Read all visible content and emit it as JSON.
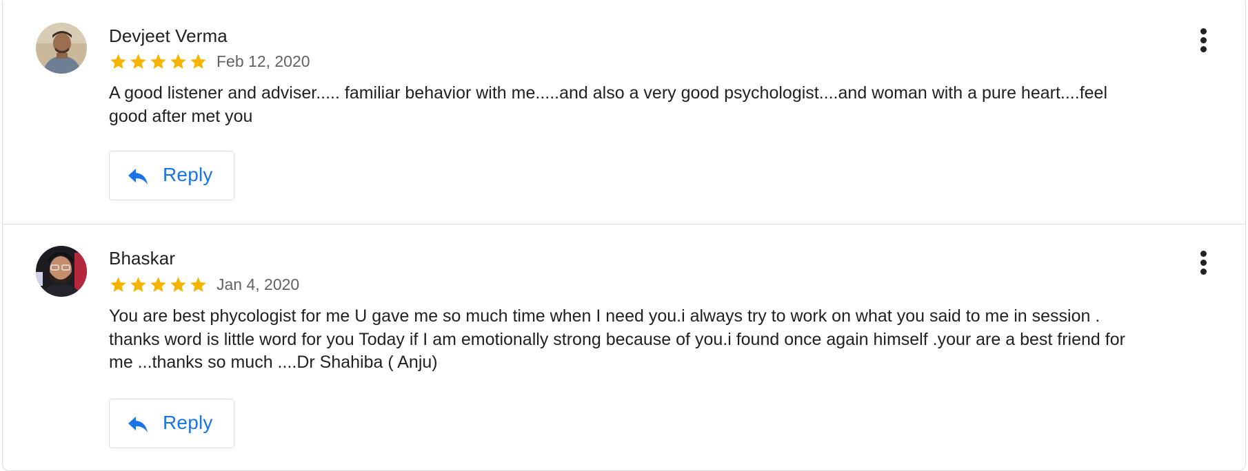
{
  "reviews": [
    {
      "author": "Devjeet Verma",
      "rating": 5,
      "max_rating": 5,
      "date": "Feb 12, 2020",
      "text": "A good listener and adviser..... familiar behavior with me.....and also a very good psychologist....and woman with a pure heart....feel good after met you",
      "reply_label": "Reply"
    },
    {
      "author": "Bhaskar",
      "rating": 5,
      "max_rating": 5,
      "date": "Jan 4, 2020",
      "text": "You are best phycologist for me U gave me so much time when I need you.i always try to work on what you said to me in session . thanks word is little word for you Today if I am emotionally strong because of you.i found once again himself .your are a best friend for me ...thanks so much ....Dr Shahiba ( Anju)",
      "reply_label": "Reply"
    }
  ],
  "colors": {
    "star": "#f4b400",
    "accent": "#1a73e8",
    "divider": "#dadce0",
    "secondary_text": "#5f6368"
  },
  "icons": {
    "star": "star-icon",
    "reply": "reply-arrow-icon",
    "more": "more-vert-icon"
  }
}
